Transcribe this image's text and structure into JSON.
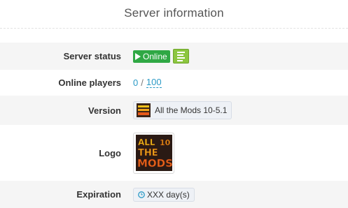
{
  "panel": {
    "title": "Server information"
  },
  "rows": {
    "status": {
      "label": "Server status",
      "badge": "Online",
      "badge_color": "#2fa844",
      "details_icon": "list-lines-icon",
      "details_color": "#8cc63f"
    },
    "players": {
      "label": "Online players",
      "current": "0",
      "separator": "/",
      "max": "100"
    },
    "version": {
      "label": "Version",
      "value": "All the Mods 10-5.1"
    },
    "logo": {
      "label": "Logo",
      "logo_text": "ALL THE 10 MODS"
    },
    "expiration": {
      "label": "Expiration",
      "icon": "clock-icon",
      "value": "XXX day(s)"
    }
  },
  "colors": {
    "stripe": "#f5f5f5",
    "link": "#2b9ac6"
  }
}
